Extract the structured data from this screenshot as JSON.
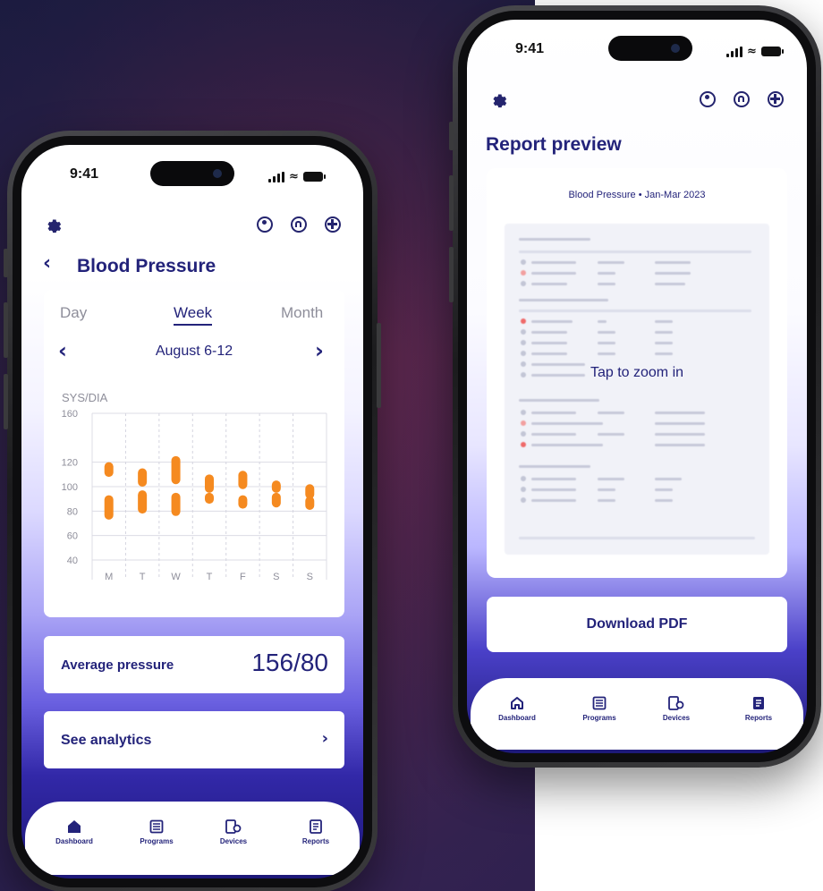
{
  "left_phone": {
    "status_time": "9:41",
    "header_title": "Blood Pressure",
    "tabs": [
      {
        "label": "Day",
        "active": false
      },
      {
        "label": "Week",
        "active": true
      },
      {
        "label": "Month",
        "active": false
      }
    ],
    "date_range": "August 6-12",
    "chart_data": {
      "type": "bar",
      "ylabel": "SYS/DIA",
      "ylim": [
        40,
        160
      ],
      "yticks": [
        "160",
        "120",
        "100",
        "80",
        "60",
        "40"
      ],
      "categories": [
        "M",
        "T",
        "W",
        "T",
        "F",
        "S",
        "S"
      ],
      "series": [
        {
          "name": "SYS",
          "ranges": [
            [
              108,
              120
            ],
            [
              100,
              115
            ],
            [
              102,
              125
            ],
            [
              95,
              110
            ],
            [
              98,
              113
            ],
            [
              95,
              105
            ],
            [
              90,
              102
            ]
          ]
        },
        {
          "name": "DIA",
          "ranges": [
            [
              73,
              93
            ],
            [
              78,
              97
            ],
            [
              76,
              95
            ],
            [
              86,
              95
            ],
            [
              82,
              93
            ],
            [
              83,
              95
            ],
            [
              81,
              92
            ]
          ]
        }
      ],
      "bar_color": "#f58a20"
    },
    "average_label": "Average pressure",
    "average_value": "156/80",
    "analytics_label": "See analytics",
    "nav": [
      {
        "label": "Dashboard",
        "icon": "home-icon"
      },
      {
        "label": "Programs",
        "icon": "list-icon"
      },
      {
        "label": "Devices",
        "icon": "devices-icon"
      },
      {
        "label": "Reports",
        "icon": "report-icon"
      }
    ]
  },
  "right_phone": {
    "status_time": "9:41",
    "header_title": "Report preview",
    "report_title": "Blood Pressure • Jan-Mar 2023",
    "zoom_hint": "Tap to zoom in",
    "download_label": "Download PDF",
    "nav": [
      {
        "label": "Dashboard",
        "icon": "home-icon"
      },
      {
        "label": "Programs",
        "icon": "list-icon"
      },
      {
        "label": "Devices",
        "icon": "devices-icon"
      },
      {
        "label": "Reports",
        "icon": "report-icon"
      }
    ]
  },
  "colors": {
    "brand": "#23237a",
    "accent": "#f58a20"
  }
}
